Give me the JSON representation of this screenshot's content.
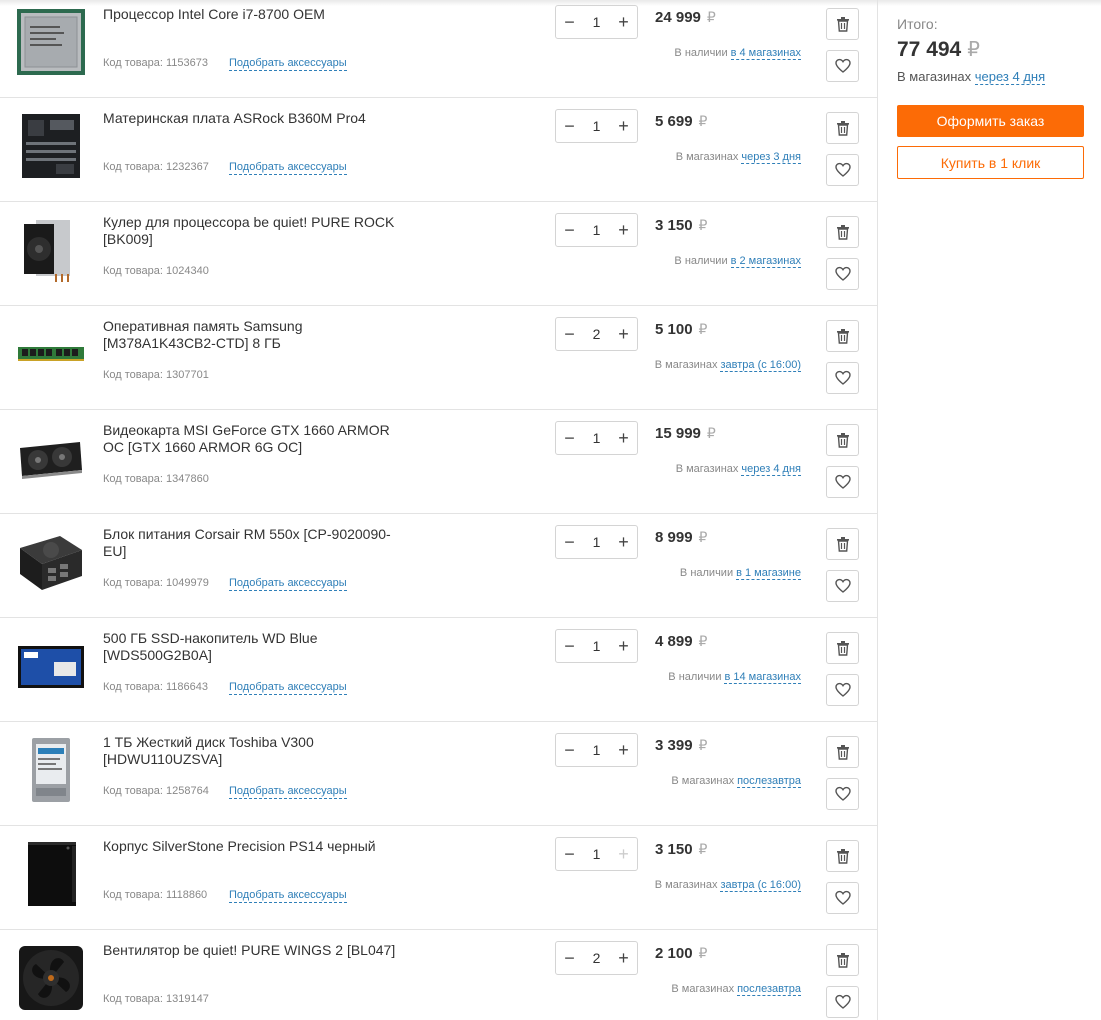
{
  "currency": "₽",
  "labels": {
    "code_prefix": "Код товара:",
    "accessories": "Подобрать аксессуары"
  },
  "items": [
    {
      "name": "Процессор Intel Core i7-8700 OEM",
      "code": "1153673",
      "qty": "1",
      "price": "24 999",
      "avail_text": "В наличии",
      "avail_link": "в 4 магазинах",
      "accessories": true,
      "image": "cpu-image",
      "plus_disabled": false
    },
    {
      "name": "Материнская плата ASRock B360M Pro4",
      "code": "1232367",
      "qty": "1",
      "price": "5 699",
      "avail_text": "В магазинах",
      "avail_link": "через 3 дня",
      "accessories": true,
      "image": "motherboard-image",
      "plus_disabled": false
    },
    {
      "name": "Кулер для процессора be quiet! PURE ROCK [BK009]",
      "code": "1024340",
      "qty": "1",
      "price": "3 150",
      "avail_text": "В наличии",
      "avail_link": "в 2 магазинах",
      "accessories": false,
      "image": "cpu-cooler-image",
      "plus_disabled": false
    },
    {
      "name": "Оперативная память Samsung [M378A1K43CB2-CTD] 8 ГБ",
      "code": "1307701",
      "qty": "2",
      "price": "5 100",
      "avail_text": "В магазинах",
      "avail_link": "завтра (с 16:00)",
      "accessories": false,
      "image": "ram-image",
      "plus_disabled": false
    },
    {
      "name": "Видеокарта MSI GeForce GTX 1660 ARMOR OC [GTX 1660 ARMOR 6G OC]",
      "code": "1347860",
      "qty": "1",
      "price": "15 999",
      "avail_text": "В магазинах",
      "avail_link": "через 4 дня",
      "accessories": false,
      "image": "gpu-image",
      "plus_disabled": false
    },
    {
      "name": "Блок питания Corsair RM 550x [CP-9020090-EU]",
      "code": "1049979",
      "qty": "1",
      "price": "8 999",
      "avail_text": "В наличии",
      "avail_link": "в 1 магазине",
      "accessories": true,
      "image": "psu-image",
      "plus_disabled": false
    },
    {
      "name": "500 ГБ SSD-накопитель WD Blue [WDS500G2B0A]",
      "code": "1186643",
      "qty": "1",
      "price": "4 899",
      "avail_text": "В наличии",
      "avail_link": "в 14 магазинах",
      "accessories": true,
      "image": "ssd-image",
      "plus_disabled": false
    },
    {
      "name": "1 ТБ Жесткий диск Toshiba V300 [HDWU110UZSVA]",
      "code": "1258764",
      "qty": "1",
      "price": "3 399",
      "avail_text": "В магазинах",
      "avail_link": "послезавтра",
      "accessories": true,
      "image": "hdd-image",
      "plus_disabled": false
    },
    {
      "name": "Корпус SilverStone Precision PS14 черный",
      "code": "1118860",
      "qty": "1",
      "price": "3 150",
      "avail_text": "В магазинах",
      "avail_link": "завтра (с 16:00)",
      "accessories": true,
      "image": "case-image",
      "plus_disabled": true
    },
    {
      "name": "Вентилятор be quiet! PURE WINGS 2 [BL047]",
      "code": "1319147",
      "qty": "2",
      "price": "2 100",
      "avail_text": "В магазинах",
      "avail_link": "послезавтра",
      "accessories": false,
      "image": "fan-image",
      "plus_disabled": false
    }
  ],
  "summary": {
    "label": "Итого:",
    "total": "77 494",
    "avail_text": "В магазинах",
    "avail_link": "через 4 дня",
    "order_button": "Оформить заказ",
    "one_click_button": "Купить в 1 клик"
  },
  "colors": {
    "accent": "#fc6b06",
    "link": "#2f7fb8",
    "border": "#e3e3e3"
  }
}
